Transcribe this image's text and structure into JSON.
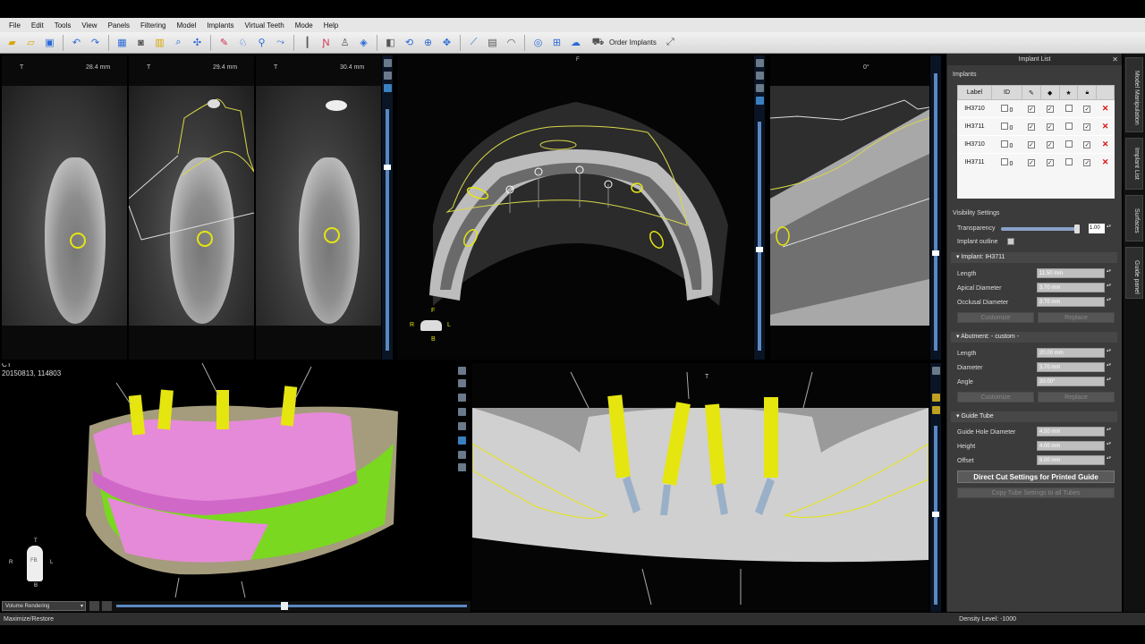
{
  "menu": [
    "File",
    "Edit",
    "Tools",
    "View",
    "Panels",
    "Filtering",
    "Model",
    "Implants",
    "Virtual Teeth",
    "Mode",
    "Help"
  ],
  "toolbar": {
    "order_implants": "Order Implants",
    "icons": [
      "open-icon",
      "open-folder-icon",
      "save-icon",
      "undo-icon",
      "redo-icon",
      "layout-icon",
      "camera-icon",
      "grid-icon",
      "zoom-icon",
      "measure-icon",
      "curve-icon",
      "tooth-icon",
      "implant-icon",
      "arch-icon",
      "nerve-icon",
      "contrast-icon",
      "rotate-icon",
      "zoom-in-icon",
      "pan-icon",
      "ruler-icon",
      "angle-icon",
      "protractor-icon",
      "surface-icon",
      "axes-icon",
      "cloud-icon",
      "cart-icon",
      "expand-icon"
    ]
  },
  "viewports": {
    "cross_sections": [
      {
        "orient": "T",
        "distance": "28.4 mm"
      },
      {
        "orient": "T",
        "distance": "29.4 mm"
      },
      {
        "orient": "T",
        "distance": "30.4 mm"
      }
    ],
    "axial": {
      "top_label": "F",
      "orient": {
        "front": "F",
        "right": "R",
        "left": "L",
        "back": "B"
      }
    },
    "panoramic": {
      "angle": "0°"
    },
    "volume": {
      "modality": "CT",
      "study": "20150813, 114803",
      "render_mode": "Volume Rendering",
      "figure": {
        "top": "T",
        "right": "R",
        "left": "L",
        "back": "B",
        "center": "FB"
      }
    },
    "curved_view": {
      "top_label": "T"
    }
  },
  "panel": {
    "title": "Implant List",
    "implants_label": "Implants",
    "table": {
      "headers": [
        "Label",
        "ID"
      ],
      "header_icons": [
        "edit-icon",
        "visible-icon",
        "star-icon",
        "lock-icon"
      ],
      "rows": [
        {
          "label": "IH3710",
          "id": "0",
          "visible": true,
          "checked": true,
          "star": false,
          "locked": true
        },
        {
          "label": "IH3711",
          "id": "0",
          "visible": true,
          "checked": true,
          "star": false,
          "locked": true
        },
        {
          "label": "IH3710",
          "id": "0",
          "visible": true,
          "checked": true,
          "star": false,
          "locked": true
        },
        {
          "label": "IH3711",
          "id": "0",
          "visible": true,
          "checked": true,
          "star": false,
          "locked": true
        }
      ]
    },
    "visibility": {
      "title": "Visibility Settings",
      "transparency_label": "Transparency",
      "transparency_value": "1.00",
      "transparency": 1.0,
      "outline_label": "Implant outline"
    },
    "implant": {
      "title": "Implant: IH3711",
      "length_label": "Length",
      "length": "11.50 mm",
      "apical_label": "Apical Diameter",
      "apical": "3.70 mm",
      "occlusal_label": "Occlusal Diameter",
      "occlusal": "3.70 mm",
      "customize": "Customize",
      "replace": "Replace"
    },
    "abutment": {
      "title": "Abutment: - custom -",
      "length_label": "Length",
      "length": "20.00 mm",
      "diameter_label": "Diameter",
      "diameter": "3.70 mm",
      "angle_label": "Angle",
      "angle": "20.00°",
      "customize": "Customize",
      "replace": "Replace"
    },
    "guide_tube": {
      "title": "Guide Tube",
      "hole_label": "Guide Hole Diameter",
      "hole": "4.50 mm",
      "height_label": "Height",
      "height": "4.00 mm",
      "offset_label": "Offset",
      "offset": "9.00 mm",
      "direct_cut": "Direct Cut Settings for Printed Guide",
      "copy_tube": "Copy Tube Settings to all Tubes"
    }
  },
  "side_tabs": [
    "Model Manipulation",
    "Implant List",
    "Surfaces",
    "Guide panel"
  ],
  "status": {
    "left": "Maximize/Restore",
    "right": "Density Level: -1000"
  },
  "colors": {
    "implant": "#e5e510",
    "outline": "#d8d84a",
    "model_pink": "#e58ad8",
    "model_green": "#7ad820"
  }
}
